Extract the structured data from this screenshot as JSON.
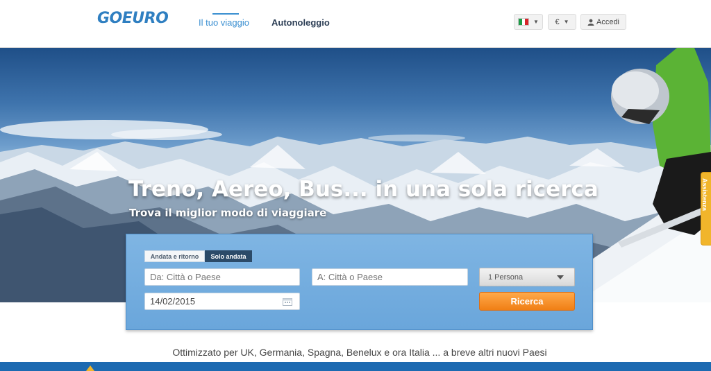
{
  "header": {
    "logo": "GOEURO",
    "nav": {
      "trip": "Il tuo viaggio",
      "car": "Autonoleggio"
    },
    "currency": "€",
    "login": "Accedi",
    "icons": {
      "flag": "italy-flag-icon",
      "user": "user-icon",
      "caret": "caret-down-icon"
    }
  },
  "hero": {
    "title": "Treno, Aereo, Bus... in una sola ricerca",
    "subtitle": "Trova il miglior modo di viaggiare"
  },
  "assistance": {
    "label": "Assistenza"
  },
  "search": {
    "trip_type": {
      "round_trip": "Andata e ritorno",
      "one_way": "Solo andata",
      "selected": "one_way"
    },
    "from_placeholder": "Da: Città o Paese",
    "to_placeholder": "A: Città o Paese",
    "date": "14/02/2015",
    "persons": "1 Persona",
    "submit": "Ricerca"
  },
  "info_text": "Ottimizzato per UK, Germania, Spagna, Benelux e ora Italia ... a breve altri nuovi Paesi",
  "colors": {
    "brand": "#2f7fc1",
    "search_bg": "#7fb5e3",
    "accent_orange": "#f07f15",
    "footer_blue": "#1d6ab1"
  }
}
